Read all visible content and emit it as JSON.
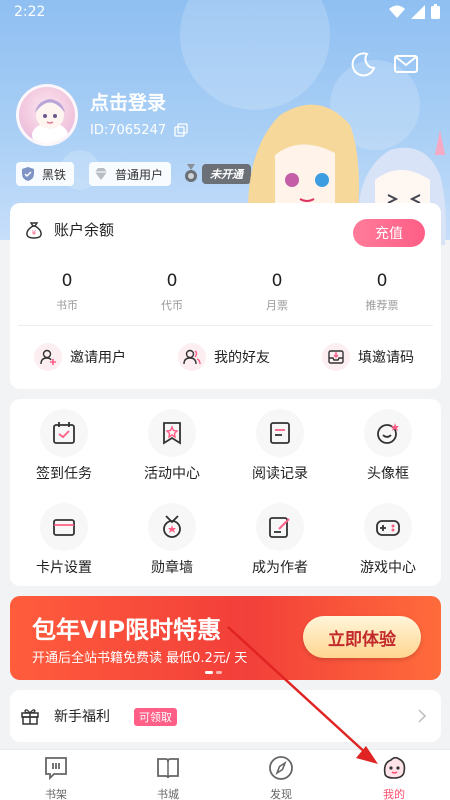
{
  "status": {
    "time": "2:22"
  },
  "profile": {
    "login_text": "点击登录",
    "user_id": "ID:7065247",
    "badges": [
      "黑铁",
      "普通用户"
    ],
    "locked_badge": "未开通"
  },
  "balance": {
    "title": "账户余额",
    "recharge_label": "充值",
    "stats": [
      {
        "value": "0",
        "label": "书币"
      },
      {
        "value": "0",
        "label": "代币"
      },
      {
        "value": "0",
        "label": "月票"
      },
      {
        "value": "0",
        "label": "推荐票"
      }
    ],
    "quick_links": [
      "邀请用户",
      "我的好友",
      "填邀请码"
    ]
  },
  "features": {
    "items": [
      {
        "label": "签到任务",
        "icon": "calendar-icon"
      },
      {
        "label": "活动中心",
        "icon": "bookmark-star-icon"
      },
      {
        "label": "阅读记录",
        "icon": "document-icon"
      },
      {
        "label": "头像框",
        "icon": "avatar-frame-icon"
      },
      {
        "label": "卡片设置",
        "icon": "card-icon"
      },
      {
        "label": "勋章墙",
        "icon": "medal-icon"
      },
      {
        "label": "成为作者",
        "icon": "edit-icon"
      },
      {
        "label": "游戏中心",
        "icon": "gamepad-icon"
      }
    ]
  },
  "vip": {
    "title": "包年VIP限时特惠",
    "subtitle": "开通后全站书籍免费读 最低0.2元/ 天",
    "button": "立即体验"
  },
  "welfare": {
    "label": "新手福利",
    "tag": "可领取"
  },
  "tabs": [
    {
      "label": "书架",
      "icon": "bookshelf-icon"
    },
    {
      "label": "书城",
      "icon": "book-icon"
    },
    {
      "label": "发现",
      "icon": "compass-icon"
    },
    {
      "label": "我的",
      "icon": "profile-icon"
    }
  ],
  "colors": {
    "accent": "#ff4d6d",
    "header": "#9cc7f3",
    "vip": "#f23f3a"
  }
}
